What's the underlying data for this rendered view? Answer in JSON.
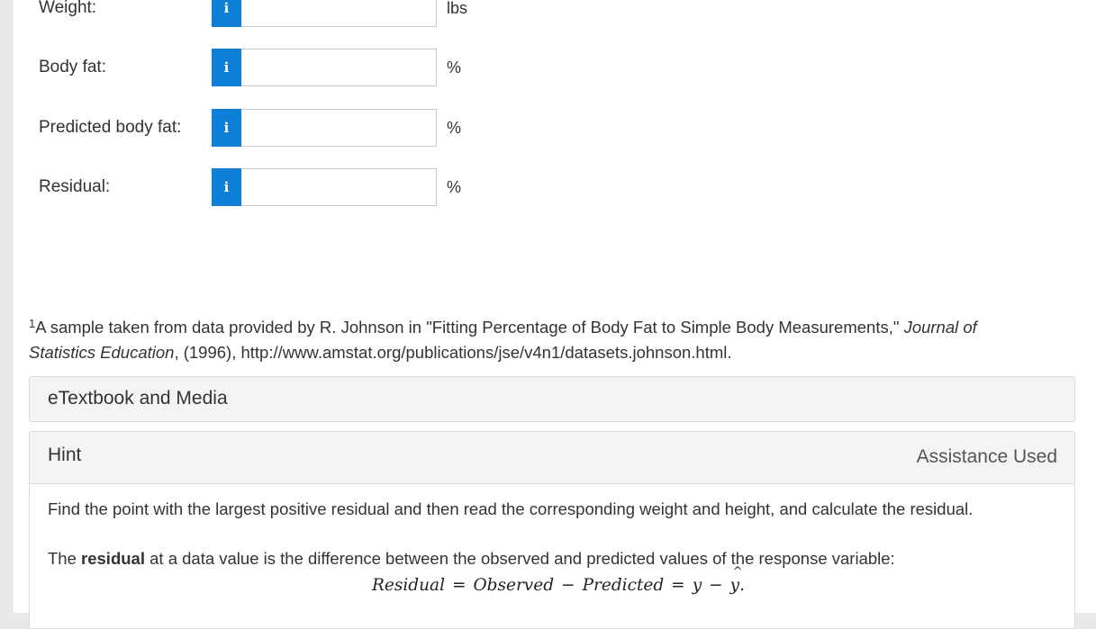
{
  "fields": [
    {
      "label": "Weight:",
      "unit": "lbs",
      "value": "",
      "info": "i"
    },
    {
      "label": "Body fat:",
      "unit": "%",
      "value": "",
      "info": "i"
    },
    {
      "label": "Predicted body fat:",
      "unit": "%",
      "value": "",
      "info": "i"
    },
    {
      "label": "Residual:",
      "unit": "%",
      "value": "",
      "info": "i"
    }
  ],
  "footnote": {
    "marker": "1",
    "text_before": "A sample taken from data provided by R. Johnson in \"Fitting Percentage of Body Fat to Simple Body Measurements,\" ",
    "journal": "Journal of Statistics Education",
    "text_after": ", (1996), http://www.amstat.org/publications/jse/v4n1/datasets.johnson.html."
  },
  "etextbook": {
    "title": "eTextbook and Media"
  },
  "hint": {
    "title": "Hint",
    "status": "Assistance Used",
    "paragraph1": "Find the point with the largest positive residual and then read the corresponding weight and height, and calculate the residual.",
    "paragraph2_before": "The ",
    "paragraph2_bold": "residual",
    "paragraph2_after": " at a data value is the difference between the observed and predicted values of the response variable:",
    "formula": {
      "residual": "Residual",
      "equals": "=",
      "observed": "Observed",
      "minus": "−",
      "predicted": "Predicted",
      "y": "y",
      "yhat": "y",
      "hat": "^",
      "period": "."
    }
  },
  "colors": {
    "info_button": "#0e7fd6",
    "panel_bg": "#f4f4f4"
  }
}
